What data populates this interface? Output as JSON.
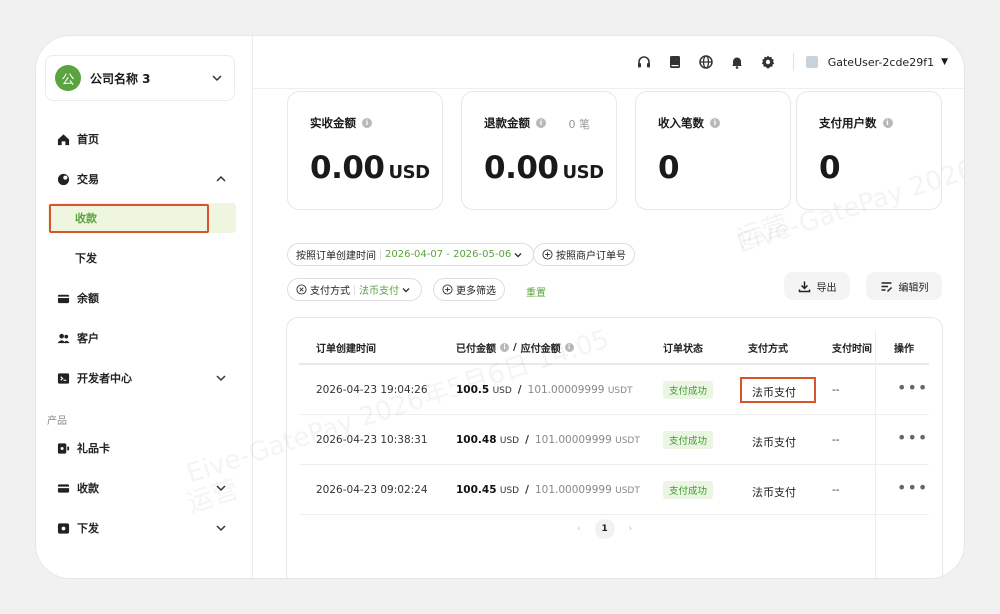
{
  "company": {
    "avatar": "公",
    "name": "公司名称 3"
  },
  "sidebar": {
    "items": [
      {
        "label": "首页",
        "icon": "home-icon"
      },
      {
        "label": "交易",
        "icon": "transaction-icon"
      },
      {
        "label": "收款"
      },
      {
        "label": "下发"
      },
      {
        "label": "余额",
        "icon": "wallet-icon"
      },
      {
        "label": "客户",
        "icon": "users-icon"
      },
      {
        "label": "开发者中心",
        "icon": "developer-icon"
      }
    ],
    "section_label": "产品",
    "products": [
      {
        "label": "礼品卡",
        "icon": "giftcard-icon"
      },
      {
        "label": "收款",
        "icon": "card-icon"
      },
      {
        "label": "下发",
        "icon": "payout-icon"
      }
    ]
  },
  "topbar": {
    "user": "GateUser-2cde29f1"
  },
  "stats": [
    {
      "title": "实收金额",
      "value": "0.00",
      "unit": "USD",
      "extra": ""
    },
    {
      "title": "退款金额",
      "value": "0.00",
      "unit": "USD",
      "extra": "0 笔"
    },
    {
      "title": "收入笔数",
      "value": "0",
      "unit": "",
      "extra": ""
    },
    {
      "title": "支付用户数",
      "value": "0",
      "unit": "",
      "extra": ""
    }
  ],
  "filters": {
    "date_label": "按照订单创建时间",
    "date_value": "2026-04-07 - 2026-05-06",
    "merchant_order": "按照商户订单号",
    "pay_method_label": "支付方式",
    "pay_method_value": "法币支付",
    "more": "更多筛选",
    "reset": "重置",
    "export": "导出",
    "edit_cols": "编辑列"
  },
  "table": {
    "headers": {
      "created": "订单创建时间",
      "paid": "已付金额",
      "payable": "应付金额",
      "status": "订单状态",
      "method": "支付方式",
      "pay_time": "支付时间",
      "ops": "操作"
    },
    "rows": [
      {
        "created": "2026-04-23 19:04:26",
        "paid": "100.5",
        "paid_unit": "USD",
        "payable": "101.00009999",
        "payable_unit": "USDT",
        "status": "支付成功",
        "method": "法币支付",
        "pay_time": "--"
      },
      {
        "created": "2026-04-23 10:38:31",
        "paid": "100.48",
        "paid_unit": "USD",
        "payable": "101.00009999",
        "payable_unit": "USDT",
        "status": "支付成功",
        "method": "法币支付",
        "pay_time": "--"
      },
      {
        "created": "2026-04-23 09:02:24",
        "paid": "100.45",
        "paid_unit": "USD",
        "payable": "101.00009999",
        "payable_unit": "USDT",
        "status": "支付成功",
        "method": "法币支付",
        "pay_time": "--"
      }
    ],
    "page": "1"
  },
  "watermarks": [
    "Eive-GatePay 2026年5月6日 14:05",
    "运营"
  ]
}
